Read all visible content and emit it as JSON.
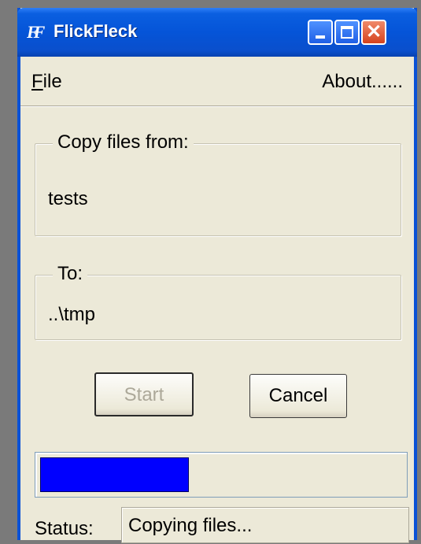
{
  "window": {
    "title": "FlickFleck",
    "icon_glyph": "FF",
    "icon_name": "flickfleck-app-icon",
    "controls": {
      "minimize_icon": "minimize-icon",
      "maximize_icon": "maximize-icon",
      "close_icon": "close-icon",
      "close_glyph": "✕"
    }
  },
  "menu": {
    "file_mnemonic": "F",
    "file_rest": "ile",
    "about": "About......"
  },
  "source": {
    "legend": "Copy files from:",
    "value": "tests"
  },
  "destination": {
    "legend": "To:",
    "value": "..\\tmp"
  },
  "buttons": {
    "start": "Start",
    "start_enabled": false,
    "cancel": "Cancel"
  },
  "progress": {
    "fraction": 0.41
  },
  "status": {
    "label": "Status:",
    "text": "Copying files..."
  },
  "colors": {
    "titlebar": "#0554d8",
    "window_bg": "#ece9d8",
    "progress_fill": "#0000ff"
  }
}
